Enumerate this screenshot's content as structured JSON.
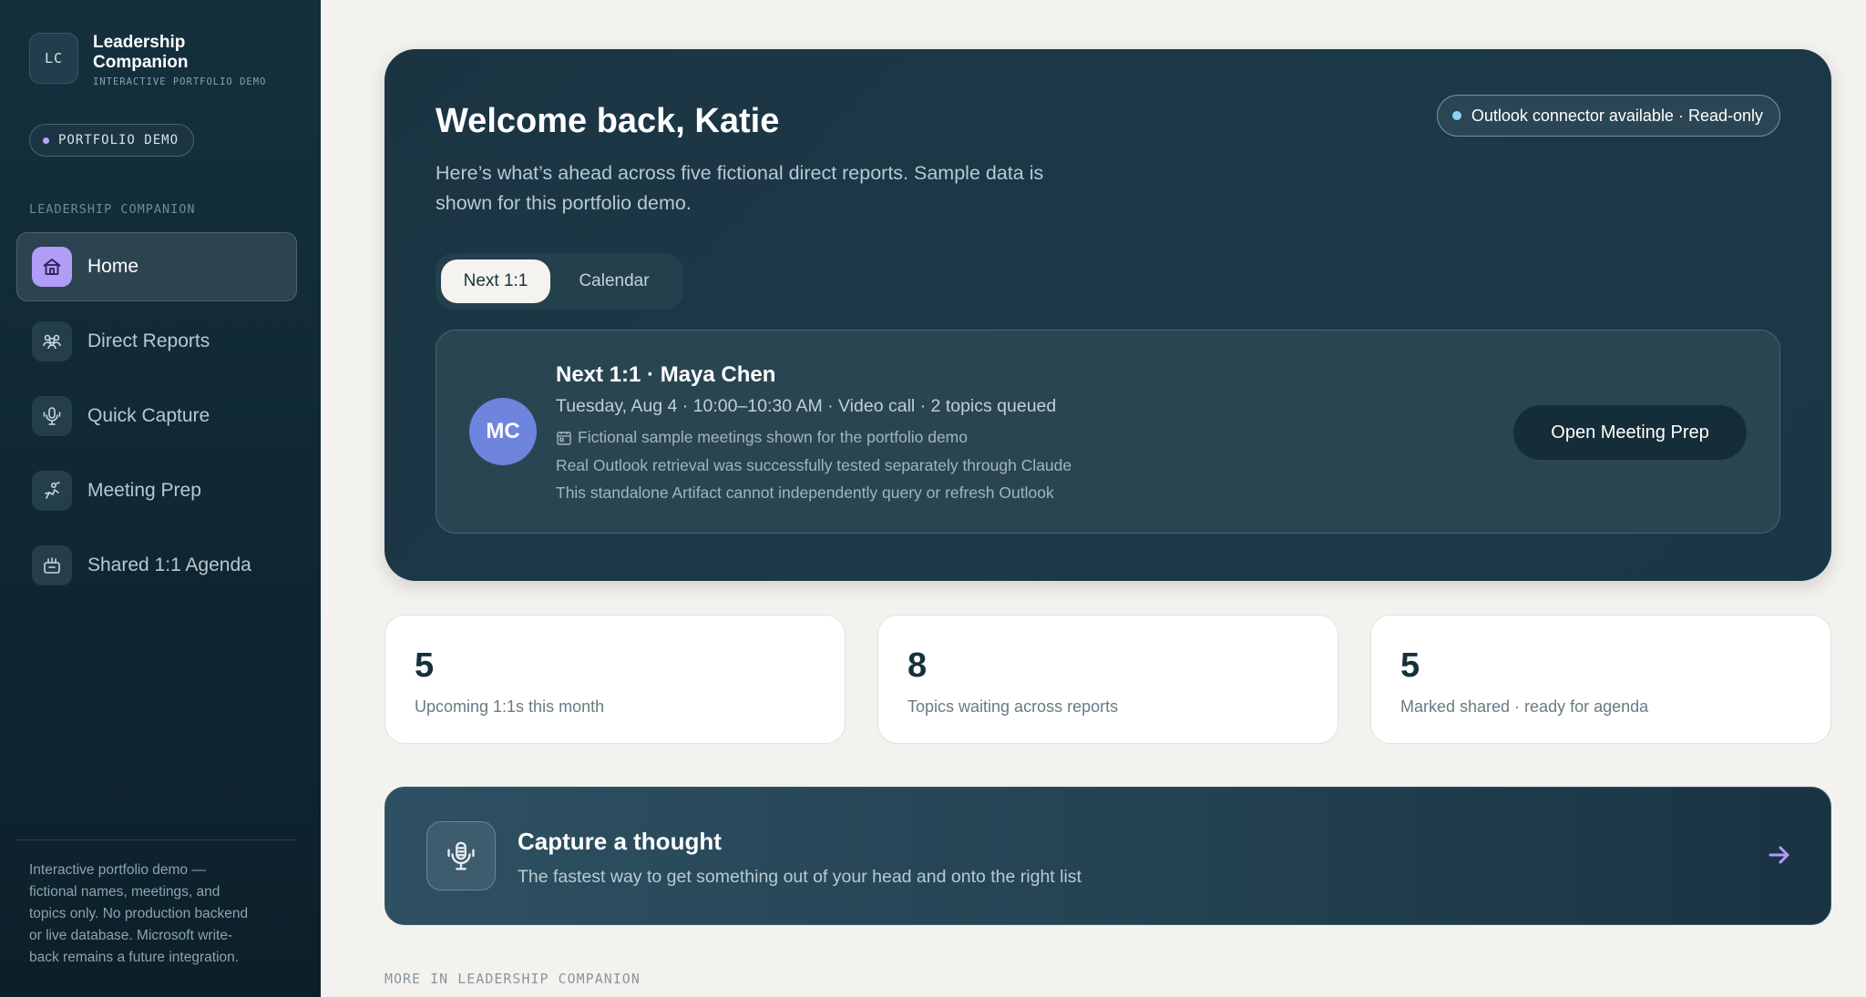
{
  "sidebar": {
    "brand": {
      "mark": "LC",
      "title": "Leadership Companion",
      "subtitle": "INTERACTIVE PORTFOLIO DEMO"
    },
    "demo_pill": "PORTFOLIO DEMO",
    "section_label": "LEADERSHIP COMPANION",
    "items": [
      {
        "label": "Home",
        "icon": "home-icon",
        "active": true
      },
      {
        "label": "Direct Reports",
        "icon": "team-icon",
        "active": false
      },
      {
        "label": "Quick Capture",
        "icon": "microphone-icon",
        "active": false
      },
      {
        "label": "Meeting Prep",
        "icon": "meeting-prep-icon",
        "active": false
      },
      {
        "label": "Shared 1:1 Agenda",
        "icon": "agenda-icon",
        "active": false
      }
    ],
    "footer": "Interactive portfolio demo — fictional names, meetings, and topics only. No production backend or live database. Microsoft write-back remains a future integration."
  },
  "hero": {
    "title": "Welcome back, Katie",
    "subtitle": "Here’s what’s ahead across five fictional direct reports. Sample data is shown for this portfolio demo.",
    "connector": "Outlook connector available · Read-only",
    "tabs": [
      {
        "label": "Next 1:1",
        "active": true
      },
      {
        "label": "Calendar",
        "active": false
      }
    ],
    "next_meeting": {
      "initials": "MC",
      "title": "Next 1:1 · Maya Chen",
      "meta": "Tuesday, Aug 4 · 10:00–10:30 AM · Video call · 2 topics queued",
      "note1": "Fictional sample meetings shown for the portfolio demo",
      "note2": "Real Outlook retrieval was successfully tested separately through Claude",
      "note3": "This standalone Artifact cannot independently query or refresh Outlook",
      "button": "Open Meeting Prep"
    }
  },
  "stats": [
    {
      "value": "5",
      "label": "Upcoming 1:1s this month"
    },
    {
      "value": "8",
      "label": "Topics waiting across reports"
    },
    {
      "value": "5",
      "label": "Marked shared · ready for agenda"
    }
  ],
  "capture": {
    "title": "Capture a thought",
    "subtitle": "The fastest way to get something out of your head and onto the right list"
  },
  "more_label": "MORE IN LEADERSHIP COMPANION",
  "colors": {
    "accent": "#b19cf6",
    "avatar": "#6f84dc",
    "sidebar_bg": "#0f2733",
    "page_bg": "#f4f2ef"
  }
}
